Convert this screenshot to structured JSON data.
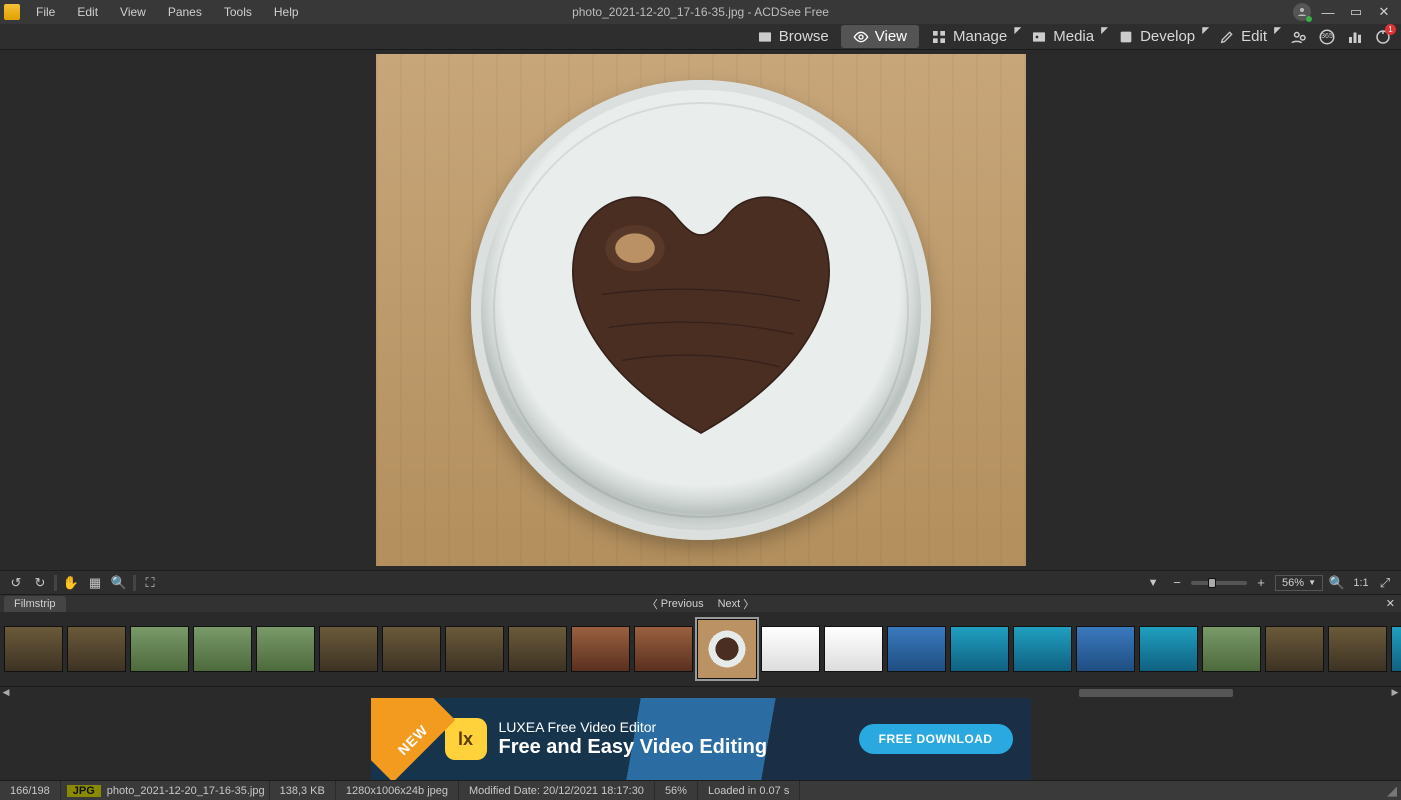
{
  "window_title": "photo_2021-12-20_17-16-35.jpg - ACDSee Free",
  "menu": {
    "file": "File",
    "edit": "Edit",
    "view": "View",
    "panes": "Panes",
    "tools": "Tools",
    "help": "Help"
  },
  "modes": {
    "browse": "Browse",
    "view": "View",
    "manage": "Manage",
    "media": "Media",
    "develop": "Develop",
    "edit": "Edit"
  },
  "notification_count": "1",
  "zoom": {
    "label": "56%"
  },
  "filmstrip": {
    "tab": "Filmstrip",
    "previous": "Previous",
    "next": "Next"
  },
  "ad": {
    "badge": "NEW",
    "line1": "LUXEA Free Video Editor",
    "line2": "Free and Easy Video Editing",
    "cta": "FREE DOWNLOAD"
  },
  "status": {
    "index": "166/198",
    "ext": "JPG",
    "filename": "photo_2021-12-20_17-16-35.jpg",
    "size": "138,3 KB",
    "dims": "1280x1006x24b jpeg",
    "modified": "Modified Date: 20/12/2021 18:17:30",
    "zoom": "56%",
    "loaded": "Loaded in 0.07 s"
  },
  "one_to_one": "1:1"
}
